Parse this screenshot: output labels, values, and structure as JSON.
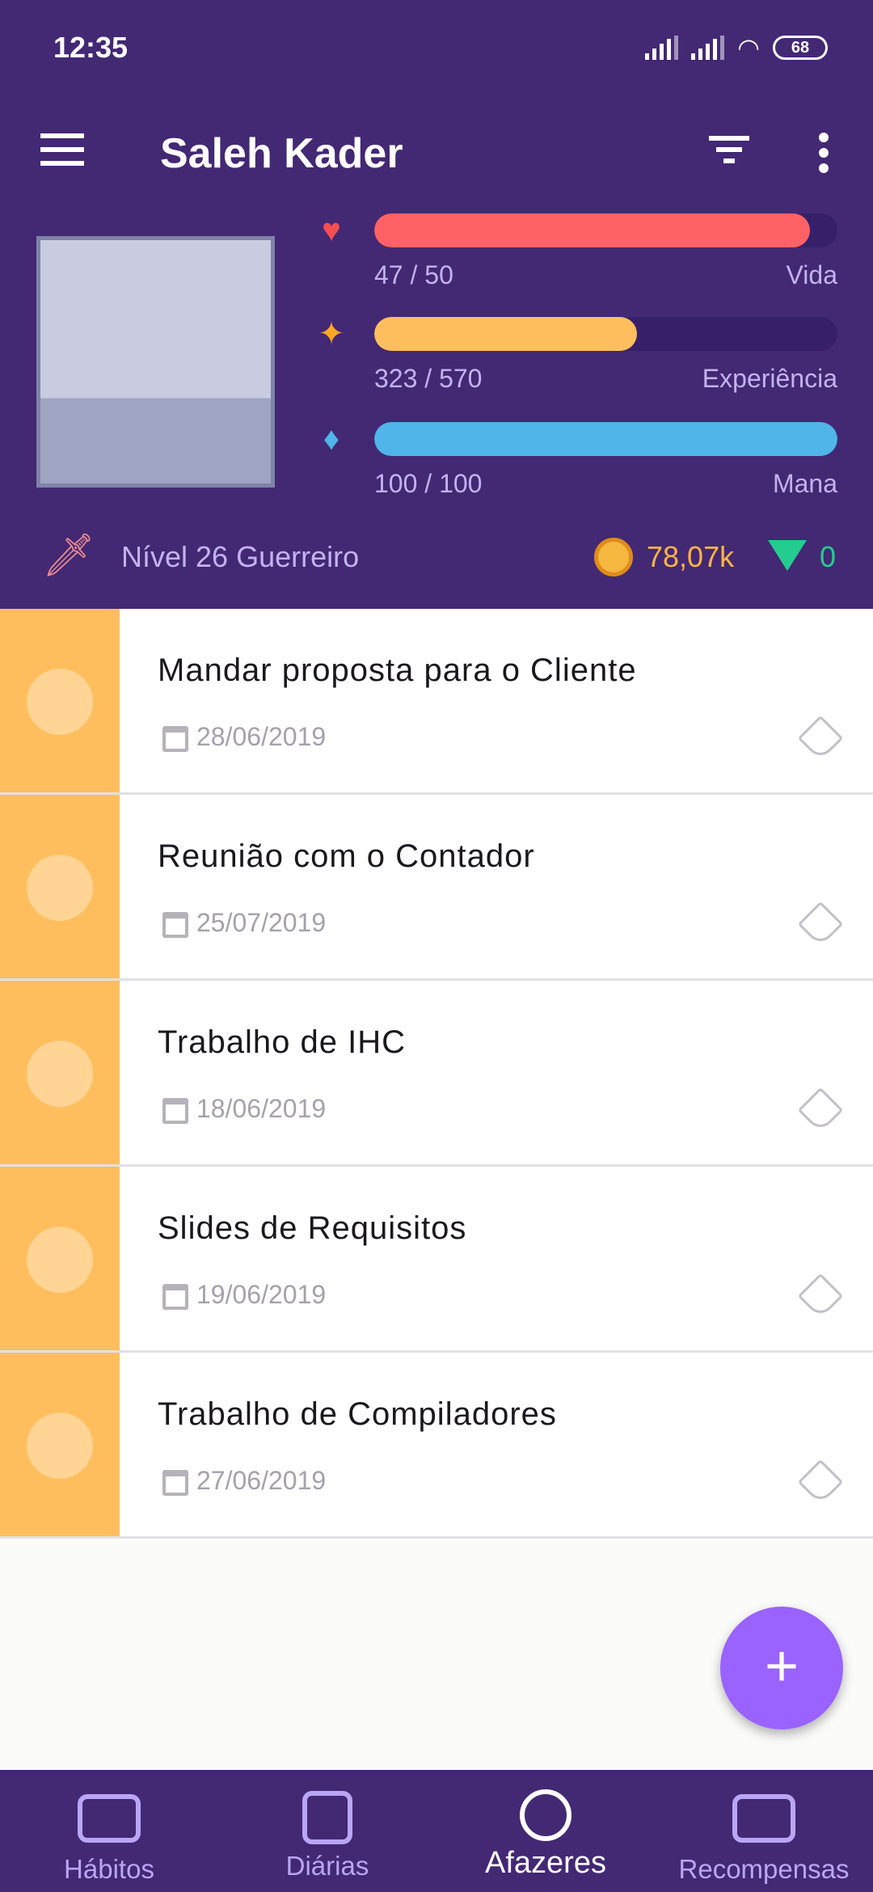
{
  "status": {
    "time": "12:35",
    "battery": "68"
  },
  "header": {
    "title": "Saleh Kader"
  },
  "stats": [
    {
      "name": "Vida",
      "value": "47 / 50",
      "fraction": 0.94,
      "color": "#ff6165"
    },
    {
      "name": "Experiência",
      "value": "323 / 570",
      "fraction": 0.567,
      "color": "#ffbe5d"
    },
    {
      "name": "Mana",
      "value": "100 / 100",
      "fraction": 1.0,
      "color": "#50b5e9"
    }
  ],
  "level": "Nível 26 Guerreiro",
  "gold": "78,07k",
  "gems": "0",
  "tasks": [
    {
      "title": "Mandar proposta para o Cliente",
      "date": "28/06/2019"
    },
    {
      "title": "Reunião com o Contador",
      "date": "25/07/2019"
    },
    {
      "title": "Trabalho de IHC",
      "date": "18/06/2019"
    },
    {
      "title": "Slides de Requisitos",
      "date": "19/06/2019"
    },
    {
      "title": "Trabalho de Compiladores",
      "date": "27/06/2019"
    }
  ],
  "fab": "+",
  "nav": [
    {
      "label": "Hábitos"
    },
    {
      "label": "Diárias"
    },
    {
      "label": "Afazeres"
    },
    {
      "label": "Recompensas"
    }
  ]
}
